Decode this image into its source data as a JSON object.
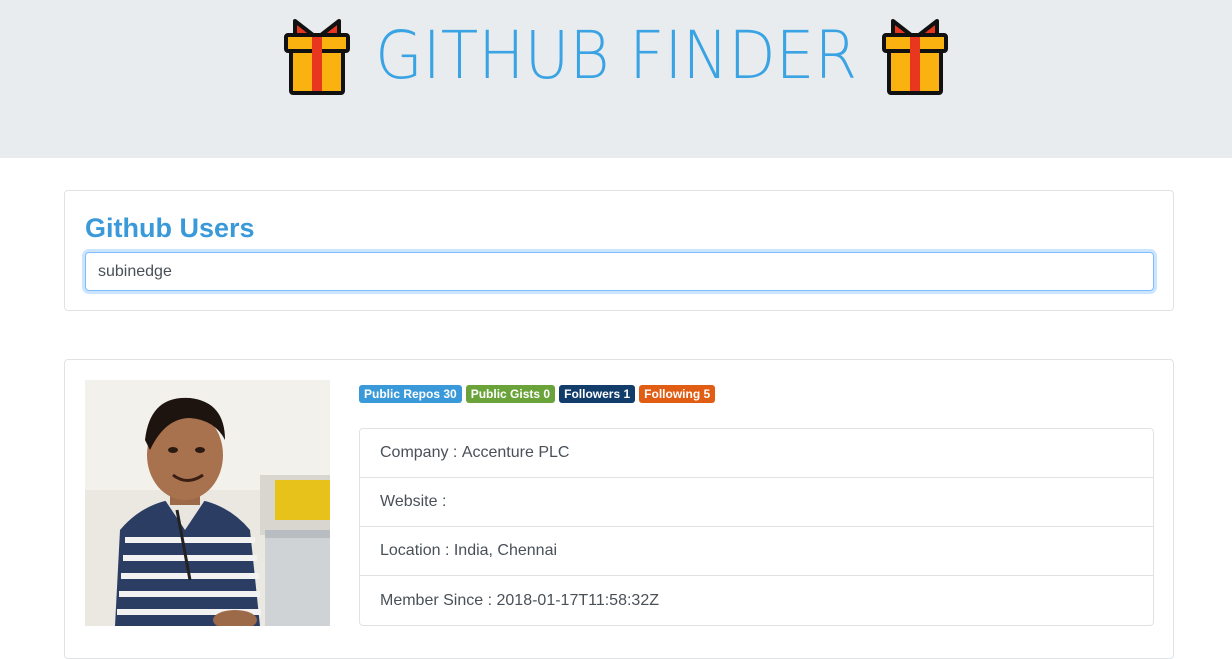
{
  "header": {
    "title": "GITHUB FINDER",
    "left_icon": "gift-icon",
    "right_icon": "gift-icon"
  },
  "search": {
    "heading": "Github Users",
    "value": "subinedge"
  },
  "profile": {
    "avatar_icon": "user-avatar-photo",
    "badges": [
      {
        "label": "Public Repos",
        "count": "30"
      },
      {
        "label": "Public Gists",
        "count": "0"
      },
      {
        "label": "Followers",
        "count": "1"
      },
      {
        "label": "Following",
        "count": "5"
      }
    ],
    "details": [
      {
        "label": "Company",
        "value": "Accenture PLC"
      },
      {
        "label": "Website",
        "value": ""
      },
      {
        "label": "Location",
        "value": "India, Chennai"
      },
      {
        "label": "Member Since",
        "value": "2018-01-17T11:58:32Z"
      }
    ]
  },
  "colors": {
    "accent": "#3aa3e3",
    "heading": "#3a9ad9",
    "badge_repos": "#3a9ad9",
    "badge_gists": "#6aa33a",
    "badge_followers": "#123d6b",
    "badge_following": "#e05d13",
    "jumbotron_bg": "#e9ecef"
  }
}
